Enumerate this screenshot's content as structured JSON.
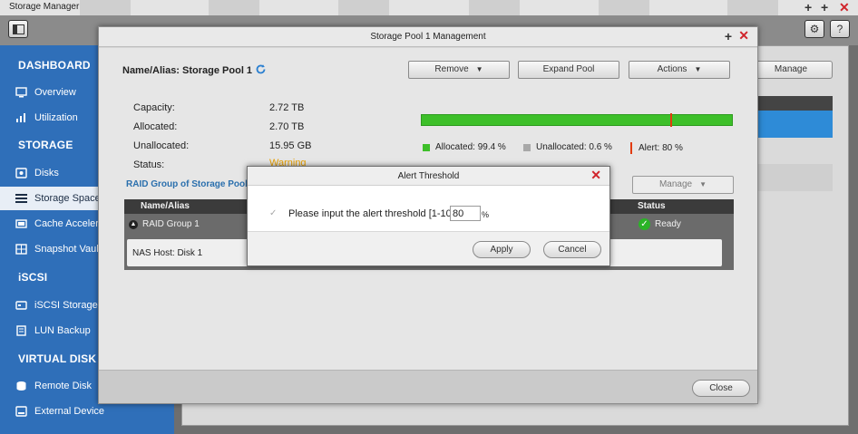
{
  "app": {
    "title": "Storage Manager",
    "minimize": "+",
    "maximize": "+",
    "close": "✕",
    "settings_icon": "gear-icon",
    "help_label": "?"
  },
  "sidebar": {
    "sections": [
      {
        "title": "DASHBOARD",
        "items": [
          "Overview",
          "Utilization"
        ]
      },
      {
        "title": "STORAGE",
        "items": [
          "Disks",
          "Storage Space",
          "Cache Accelerat",
          "Snapshot Vault"
        ]
      },
      {
        "title": "iSCSI",
        "items": [
          "iSCSI Storage",
          "LUN Backup"
        ]
      },
      {
        "title": "VIRTUAL DISK",
        "items": [
          "Remote Disk",
          "External Device"
        ]
      }
    ],
    "active_item": "Storage Space"
  },
  "background": {
    "manage_label": "Manage"
  },
  "pool_window": {
    "title": "Storage Pool 1 Management",
    "plus": "+",
    "close": "✕",
    "alias": "Name/Alias: Storage Pool 1",
    "buttons": {
      "remove": "Remove",
      "expand": "Expand Pool",
      "actions": "Actions"
    },
    "capacity": {
      "labels": [
        "Capacity:",
        "Allocated:",
        "Unallocated:",
        "Status:"
      ],
      "values": [
        "2.72 TB",
        "2.70 TB",
        "15.95 GB",
        "Warning"
      ]
    },
    "usage": {
      "allocated_fraction": 0.994,
      "alert_fraction": 0.8,
      "legend_allocated": "Allocated: 99.4 %",
      "legend_unallocated": "Unallocated: 0.6 %",
      "legend_alert": "Alert: 80 %",
      "colors": {
        "allocated": "#3dbf29",
        "unallocated": "#a8a8a8",
        "alert": "#e23b0e"
      }
    },
    "raid": {
      "title": "RAID Group of Storage Pool 1",
      "manage": "Manage",
      "col_name": "Name/Alias",
      "col_status": "Status",
      "group_name": "RAID Group 1",
      "group_status": "Ready",
      "host": "NAS Host: Disk 1"
    },
    "close_button": "Close"
  },
  "dialog": {
    "title": "Alert Threshold",
    "close": "✕",
    "checkbox_mark": "✓",
    "label": "Please input the alert threshold [1-100]",
    "value": "80",
    "unit": "%",
    "apply": "Apply",
    "cancel": "Cancel"
  }
}
